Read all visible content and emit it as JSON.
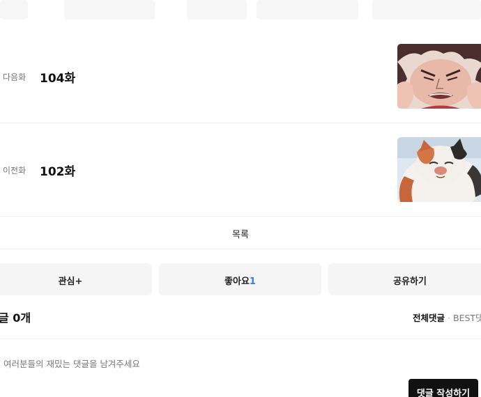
{
  "episodes": {
    "next": {
      "label": "다음화",
      "title": "104화",
      "thumbnail_icon": "next-episode-thumbnail"
    },
    "prev": {
      "label": "이전화",
      "title": "102화",
      "thumbnail_icon": "prev-episode-thumbnail"
    }
  },
  "list_button": {
    "label": "목록"
  },
  "actions": {
    "favorite": {
      "label": "관심+"
    },
    "like": {
      "label": "좋아요",
      "count": "1"
    },
    "share": {
      "label": "공유하기"
    }
  },
  "comments": {
    "count_label": "글 0개",
    "sort_all": "전체댓글",
    "sort_separator": "·",
    "sort_best": "BEST댓",
    "placeholder": "여러분들의 재밌는 댓글을 남겨주세요",
    "write_button": "댓글 작성하기"
  },
  "colors": {
    "accent": "#2f7bf6",
    "button_bg": "#f5f5f5",
    "write_button_bg": "#111111"
  }
}
